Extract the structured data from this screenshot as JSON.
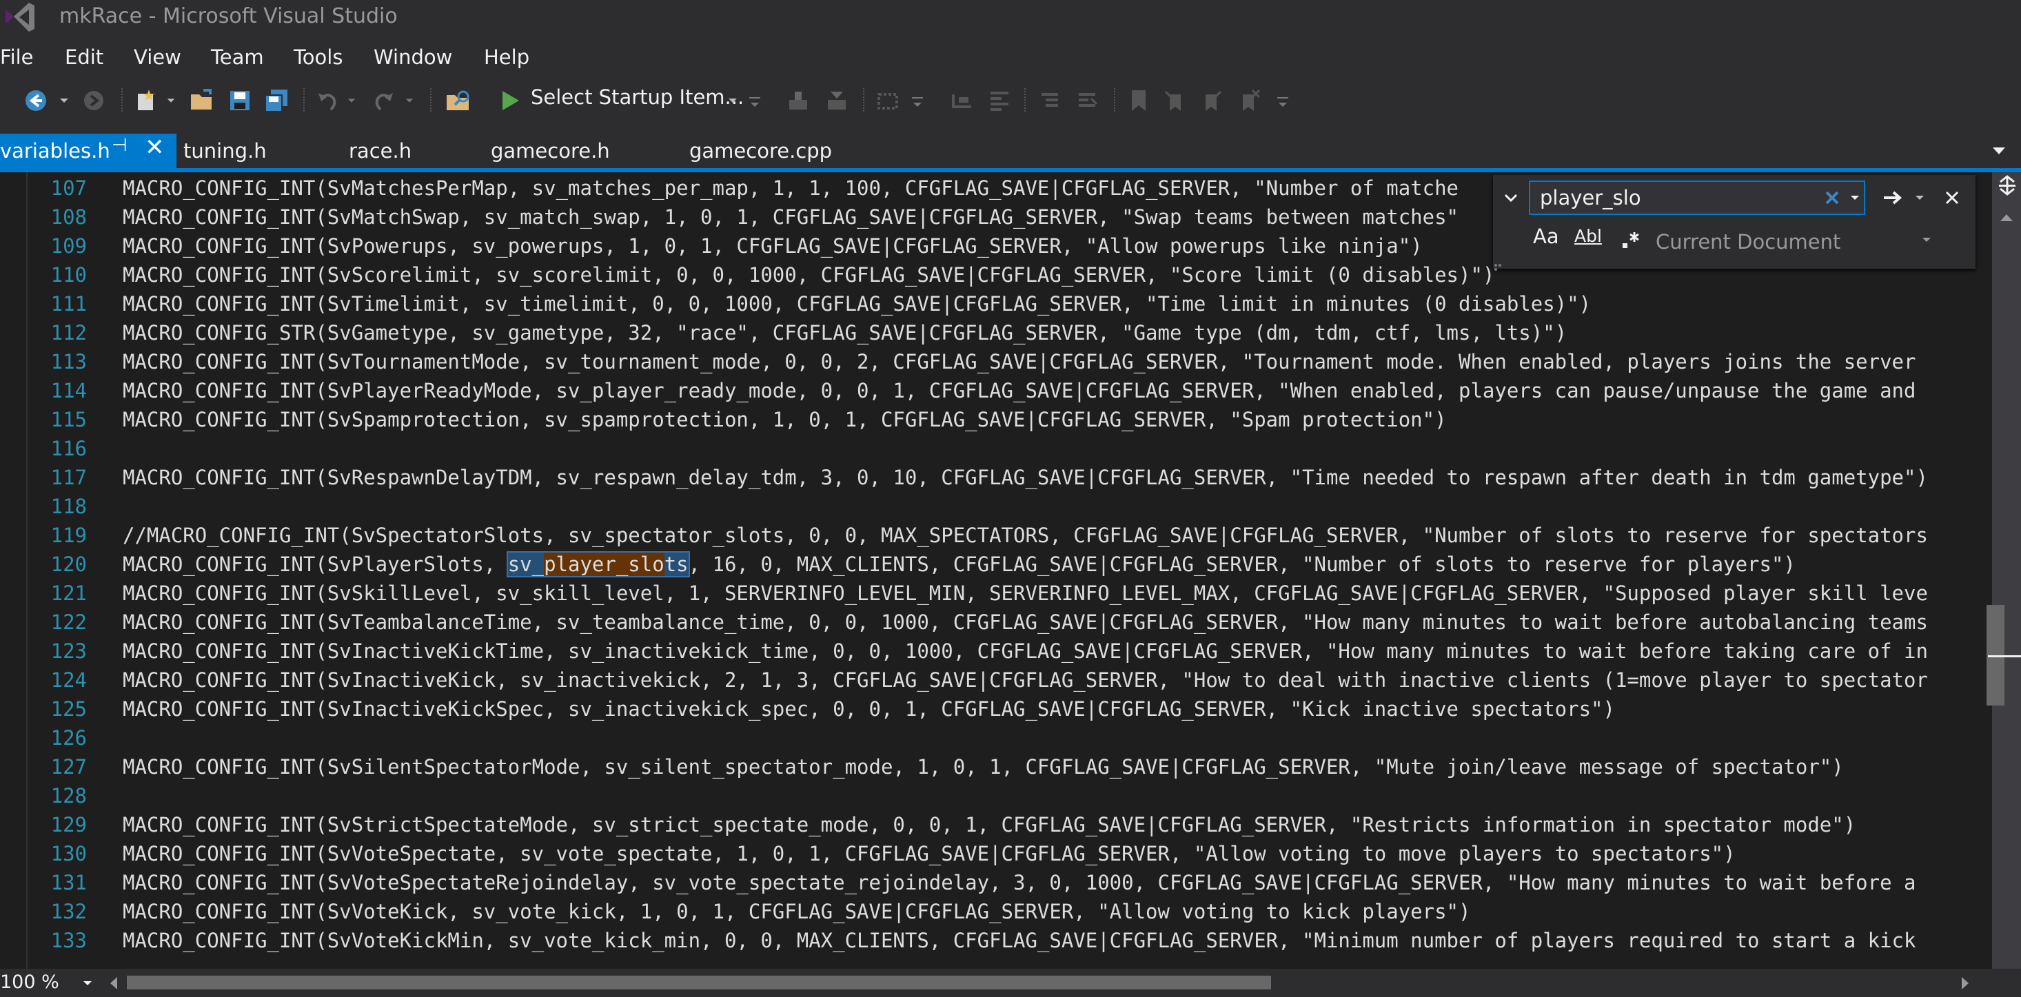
{
  "window": {
    "title": "mkRace - Microsoft Visual Studio"
  },
  "menu": [
    "File",
    "Edit",
    "View",
    "Team",
    "Tools",
    "Window",
    "Help"
  ],
  "toolbar": {
    "startup_label": "Select Startup Item..."
  },
  "tabs": [
    {
      "label": "variables.h",
      "active": true
    },
    {
      "label": "tuning.h",
      "active": false
    },
    {
      "label": "race.h",
      "active": false
    },
    {
      "label": "gamecore.h",
      "active": false
    },
    {
      "label": "gamecore.cpp",
      "active": false
    }
  ],
  "find": {
    "query": "player_slo",
    "scope": "Current Document",
    "opt_case": "Aa",
    "opt_word": "Abl"
  },
  "zoom": "100 %",
  "highlight": {
    "line_number": "120",
    "before": "MACRO_CONFIG_INT(SvPlayerSlots, ",
    "pre": "sv_",
    "match": "player_slo",
    "post": "ts",
    "after": ", 16, 0, MAX_CLIENTS, CFGFLAG_SAVE|CFGFLAG_SERVER, \"Number of slots to reserve for players\")"
  },
  "lines": [
    {
      "n": "107",
      "text": "MACRO_CONFIG_INT(SvMatchesPerMap, sv_matches_per_map, 1, 1, 100, CFGFLAG_SAVE|CFGFLAG_SERVER, \"Number of matche"
    },
    {
      "n": "108",
      "text": "MACRO_CONFIG_INT(SvMatchSwap, sv_match_swap, 1, 0, 1, CFGFLAG_SAVE|CFGFLAG_SERVER, \"Swap teams between matches\""
    },
    {
      "n": "109",
      "text": "MACRO_CONFIG_INT(SvPowerups, sv_powerups, 1, 0, 1, CFGFLAG_SAVE|CFGFLAG_SERVER, \"Allow powerups like ninja\")"
    },
    {
      "n": "110",
      "text": "MACRO_CONFIG_INT(SvScorelimit, sv_scorelimit, 0, 0, 1000, CFGFLAG_SAVE|CFGFLAG_SERVER, \"Score limit (0 disables)\")"
    },
    {
      "n": "111",
      "text": "MACRO_CONFIG_INT(SvTimelimit, sv_timelimit, 0, 0, 1000, CFGFLAG_SAVE|CFGFLAG_SERVER, \"Time limit in minutes (0 disables)\")"
    },
    {
      "n": "112",
      "text": "MACRO_CONFIG_STR(SvGametype, sv_gametype, 32, \"race\", CFGFLAG_SAVE|CFGFLAG_SERVER, \"Game type (dm, tdm, ctf, lms, lts)\")"
    },
    {
      "n": "113",
      "text": "MACRO_CONFIG_INT(SvTournamentMode, sv_tournament_mode, 0, 0, 2, CFGFLAG_SAVE|CFGFLAG_SERVER, \"Tournament mode. When enabled, players joins the server"
    },
    {
      "n": "114",
      "text": "MACRO_CONFIG_INT(SvPlayerReadyMode, sv_player_ready_mode, 0, 0, 1, CFGFLAG_SAVE|CFGFLAG_SERVER, \"When enabled, players can pause/unpause the game and"
    },
    {
      "n": "115",
      "text": "MACRO_CONFIG_INT(SvSpamprotection, sv_spamprotection, 1, 0, 1, CFGFLAG_SAVE|CFGFLAG_SERVER, \"Spam protection\")"
    },
    {
      "n": "116",
      "text": ""
    },
    {
      "n": "117",
      "text": "MACRO_CONFIG_INT(SvRespawnDelayTDM, sv_respawn_delay_tdm, 3, 0, 10, CFGFLAG_SAVE|CFGFLAG_SERVER, \"Time needed to respawn after death in tdm gametype\")"
    },
    {
      "n": "118",
      "text": ""
    },
    {
      "n": "119",
      "text": "//MACRO_CONFIG_INT(SvSpectatorSlots, sv_spectator_slots, 0, 0, MAX_SPECTATORS, CFGFLAG_SAVE|CFGFLAG_SERVER, \"Number of slots to reserve for spectators"
    },
    {
      "n": "120",
      "text": ""
    },
    {
      "n": "121",
      "text": "MACRO_CONFIG_INT(SvSkillLevel, sv_skill_level, 1, SERVERINFO_LEVEL_MIN, SERVERINFO_LEVEL_MAX, CFGFLAG_SAVE|CFGFLAG_SERVER, \"Supposed player skill leve"
    },
    {
      "n": "122",
      "text": "MACRO_CONFIG_INT(SvTeambalanceTime, sv_teambalance_time, 0, 0, 1000, CFGFLAG_SAVE|CFGFLAG_SERVER, \"How many minutes to wait before autobalancing teams"
    },
    {
      "n": "123",
      "text": "MACRO_CONFIG_INT(SvInactiveKickTime, sv_inactivekick_time, 0, 0, 1000, CFGFLAG_SAVE|CFGFLAG_SERVER, \"How many minutes to wait before taking care of in"
    },
    {
      "n": "124",
      "text": "MACRO_CONFIG_INT(SvInactiveKick, sv_inactivekick, 2, 1, 3, CFGFLAG_SAVE|CFGFLAG_SERVER, \"How to deal with inactive clients (1=move player to spectator"
    },
    {
      "n": "125",
      "text": "MACRO_CONFIG_INT(SvInactiveKickSpec, sv_inactivekick_spec, 0, 0, 1, CFGFLAG_SAVE|CFGFLAG_SERVER, \"Kick inactive spectators\")"
    },
    {
      "n": "126",
      "text": ""
    },
    {
      "n": "127",
      "text": "MACRO_CONFIG_INT(SvSilentSpectatorMode, sv_silent_spectator_mode, 1, 0, 1, CFGFLAG_SAVE|CFGFLAG_SERVER, \"Mute join/leave message of spectator\")"
    },
    {
      "n": "128",
      "text": ""
    },
    {
      "n": "129",
      "text": "MACRO_CONFIG_INT(SvStrictSpectateMode, sv_strict_spectate_mode, 0, 0, 1, CFGFLAG_SAVE|CFGFLAG_SERVER, \"Restricts information in spectator mode\")"
    },
    {
      "n": "130",
      "text": "MACRO_CONFIG_INT(SvVoteSpectate, sv_vote_spectate, 1, 0, 1, CFGFLAG_SAVE|CFGFLAG_SERVER, \"Allow voting to move players to spectators\")"
    },
    {
      "n": "131",
      "text": "MACRO_CONFIG_INT(SvVoteSpectateRejoindelay, sv_vote_spectate_rejoindelay, 3, 0, 1000, CFGFLAG_SAVE|CFGFLAG_SERVER, \"How many minutes to wait before a"
    },
    {
      "n": "132",
      "text": "MACRO_CONFIG_INT(SvVoteKick, sv_vote_kick, 1, 0, 1, CFGFLAG_SAVE|CFGFLAG_SERVER, \"Allow voting to kick players\")"
    },
    {
      "n": "133",
      "text": "MACRO_CONFIG_INT(SvVoteKickMin, sv_vote_kick_min, 0, 0, MAX_CLIENTS, CFGFLAG_SAVE|CFGFLAG_SERVER, \"Minimum number of players required to start a kick"
    }
  ],
  "colors": {
    "accent": "#007acc",
    "editor_bg": "#1e1e1e",
    "line_number": "#2b91af",
    "chrome_bg": "#2d2d30"
  }
}
